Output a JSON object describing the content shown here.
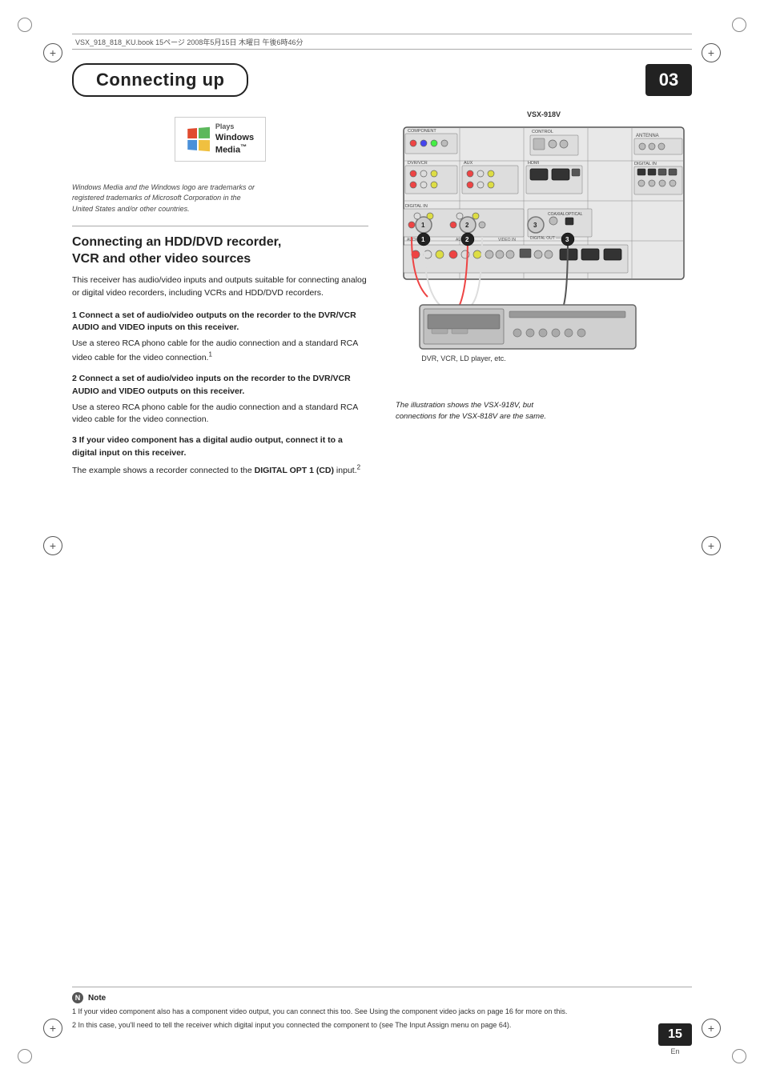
{
  "header": {
    "file_info": "VSX_918_818_KU.book  15ページ  2008年5月15日  木曜日  午後6時46分"
  },
  "chapter": {
    "title": "Connecting up",
    "number": "03"
  },
  "media_logo": {
    "brand_line1": "Plays",
    "brand_line2": "Windows",
    "brand_line3": "Media™",
    "disclaimer": "Windows Media and the Windows logo are trademarks or\nregistered trademarks of Microsoft Corporation in the\nUnited States and/or other countries."
  },
  "section": {
    "heading": "Connecting an HDD/DVD recorder,\nVCR and other video sources",
    "intro": "This receiver has audio/video inputs and outputs suitable for connecting analog or digital video recorders, including VCRs and HDD/DVD recorders.",
    "steps": [
      {
        "num": "1",
        "title": "Connect a set of audio/video outputs on the recorder to the DVR/VCR AUDIO and VIDEO inputs on this receiver.",
        "body": "Use a stereo RCA phono cable for the audio connection and a standard RCA video cable for the video connection.¹"
      },
      {
        "num": "2",
        "title": "Connect a set of audio/video inputs on the recorder to the DVR/VCR AUDIO and VIDEO outputs on this receiver.",
        "body": "Use a stereo RCA phono cable for the audio connection and a standard RCA video cable for the video connection."
      },
      {
        "num": "3",
        "title": "If your video component has a digital audio output, connect it to a digital input on this receiver.",
        "body": "The example shows a recorder connected to the DIGITAL OPT 1 (CD) input.²"
      }
    ]
  },
  "diagram": {
    "model_label": "VSX-918V",
    "dvr_label": "DVR, VCR, LD player, etc.",
    "caption": "The illustration shows the VSX-918V, but\nconnections for the VSX-818V are the same."
  },
  "notes": {
    "title": "Note",
    "items": [
      "1  If your video component also has a component video output, you can connect this too. See Using the component video jacks on page 16 for more on this.",
      "2  In this case, you'll need to tell the receiver which digital input you connected the component to (see The Input Assign menu on page 64)."
    ]
  },
  "page": {
    "number": "15",
    "lang": "En"
  }
}
